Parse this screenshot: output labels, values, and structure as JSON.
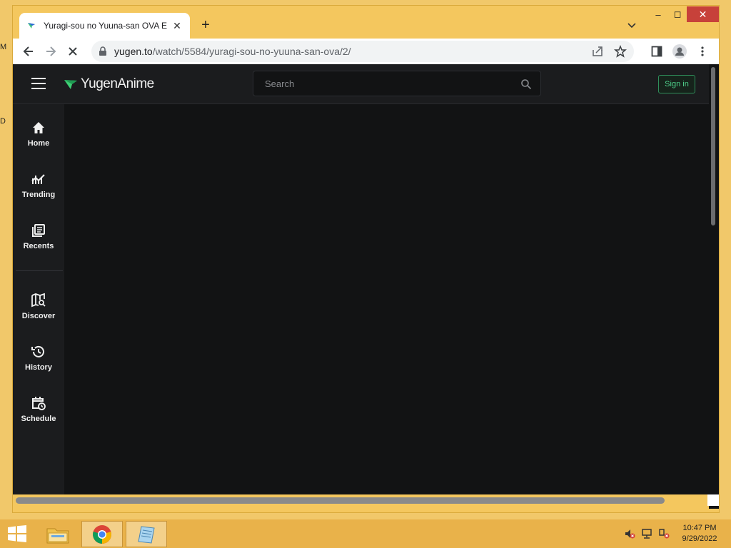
{
  "desktop": {
    "edge_letters": [
      "M",
      "D"
    ]
  },
  "window": {
    "minimize": "–",
    "maximize": "◻",
    "close": "✕"
  },
  "browser": {
    "tab_title": "Yuragi-sou no Yuuna-san OVA Ep",
    "tab_close": "✕",
    "new_tab": "+",
    "url_host": "yugen.to",
    "url_path": "/watch/5584/yuragi-sou-no-yuuna-san-ova/2/"
  },
  "site": {
    "logo_text": "YugenAnime",
    "search_placeholder": "Search",
    "sign_in": "Sign in",
    "sidebar": [
      {
        "label": "Home",
        "icon": "home-icon"
      },
      {
        "label": "Trending",
        "icon": "trending-icon"
      },
      {
        "label": "Recents",
        "icon": "recents-icon"
      },
      {
        "label": "Discover",
        "icon": "discover-icon"
      },
      {
        "label": "History",
        "icon": "history-icon"
      },
      {
        "label": "Schedule",
        "icon": "schedule-icon"
      }
    ]
  },
  "taskbar": {
    "apps": [
      "file-explorer-icon",
      "chrome-icon",
      "notepad-icon"
    ],
    "time": "10:47 PM",
    "date": "9/29/2022"
  },
  "colors": {
    "accent_green": "#4fd18b",
    "window_frame": "#f4c75e",
    "taskbar": "#e9b24a",
    "close_red": "#c7413a"
  }
}
